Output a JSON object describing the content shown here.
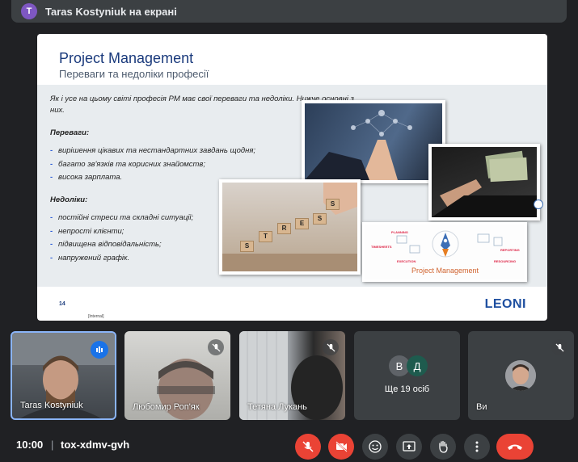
{
  "banner": {
    "avatar_letter": "T",
    "text": "Taras Kostyniuk на екрані"
  },
  "slide": {
    "title": "Project Management",
    "subtitle": "Переваги та недоліки професії",
    "intro": "Як і усе на цьому світі професія PM має свої переваги та недоліки. Нижче основні з них.",
    "pros_heading": "Переваги:",
    "pros": [
      "вирішення цікавих та нестандартних завдань щодня;",
      "багато зв'язків та корисних знайомств;",
      "висока зарплата."
    ],
    "cons_heading": "Недоліки:",
    "cons": [
      "постійні стреси та складні ситуації;",
      "непрості клієнти;",
      "підвищена відповідальність;",
      "напружений графік."
    ],
    "page_number": "14",
    "internal_label": "[Internal]",
    "logo": "LEONI",
    "stress_letters": [
      "S",
      "T",
      "R",
      "E",
      "S",
      "S"
    ],
    "pm_image_caption": "Project Management",
    "pm_diagram_labels": [
      "PLANNING",
      "TIMESHEETS",
      "EXECUTION",
      "REPORTING",
      "RESOURCING"
    ]
  },
  "participants": [
    {
      "name": "Taras Kostyniuk",
      "state": "speaking"
    },
    {
      "name": "Любомир Роп'як",
      "state": "muted"
    },
    {
      "name": "Тетяна Лукань",
      "state": "muted"
    }
  ],
  "others_tile": {
    "initials": [
      "В",
      "Д"
    ],
    "label": "Ще 19 осіб"
  },
  "self_tile": {
    "name": "Ви",
    "state": "muted"
  },
  "bottom": {
    "time": "10:00",
    "separator": "|",
    "meeting_code": "tox-xdmv-gvh"
  },
  "colors": {
    "accent": "#8ab4f8",
    "danger": "#ea4335",
    "bg": "#202124"
  }
}
